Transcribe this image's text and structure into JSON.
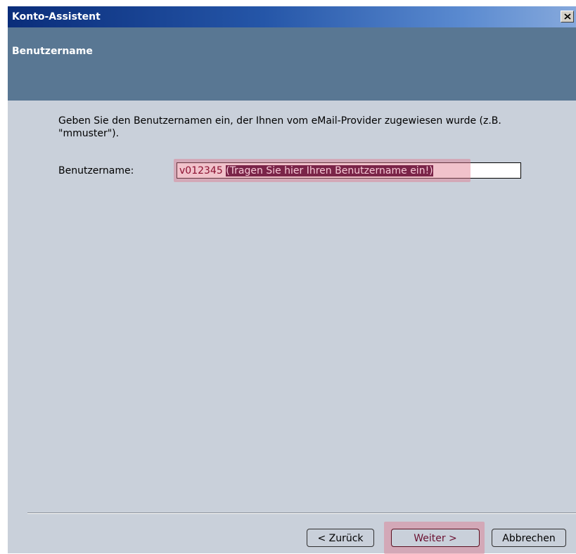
{
  "window": {
    "title": "Konto-Assistent",
    "close_icon": "close-icon"
  },
  "header": {
    "title": "Benutzername"
  },
  "content": {
    "description": "Geben Sie den Benutzernamen ein, der Ihnen vom eMail-Provider zugewiesen wurde (z.B. \"mmuster\").",
    "username_label": "Benutzername:",
    "username_value": "v012345",
    "username_hint": "(Tragen Sie hier Ihren Benutzername ein!)"
  },
  "buttons": {
    "back": "< Zurück",
    "next": "Weiter >",
    "cancel": "Abbrechen"
  },
  "colors": {
    "titlebar": "#0a2d7a",
    "header_band": "#597793",
    "dialog_bg": "#c9d0da",
    "highlight": "#e0788c"
  }
}
